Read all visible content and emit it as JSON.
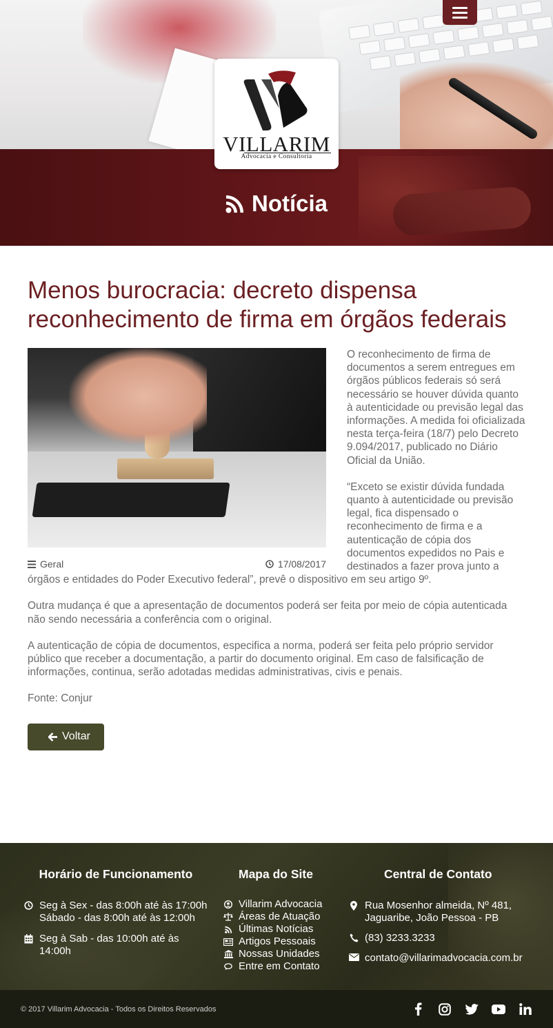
{
  "header": {
    "logo_name": "Villarim",
    "logo_subtitle": "Advocacia e Consultoria",
    "page_title": "Notícia",
    "menu_icon": "hamburger-icon",
    "title_icon": "rss-icon"
  },
  "article": {
    "title": "Menos burocracia: decreto dispensa reconhecimento de firma em órgãos federais",
    "category": "Geral",
    "date": "17/08/2017",
    "paragraphs": [
      "O reconhecimento de firma de documentos a serem entregues em órgãos públicos federais só será necessário se houver dúvida quanto à autenticidade ou previsão legal das informações. A medida foi oficializada nesta terça-feira (18/7) pelo Decreto 9.094/2017, publicado no Diário Oficial da União.",
      "“Exceto se existir dúvida fundada quanto à autenticidade ou previsão legal, fica dispensado o reconhecimento de firma e a autenticação de cópia dos documentos expedidos no Pais e destinados a fazer prova junto a órgãos e entidades do Poder Executivo federal”, prevê o dispositivo em seu artigo 9º.",
      "Outra mudança é que a apresentação de documentos poderá ser feita por meio de cópia autenticada não sendo necessária a conferência com o original.",
      "A autenticação de cópia de documentos, especifica a norma, poderá ser feita pelo próprio servidor público que receber a documentação, a partir do documento original. Em caso de falsificação de informações, continua, serão adotadas medidas administrativas, civis e penais.",
      "Fonte: Conjur"
    ],
    "back_button": "Voltar"
  },
  "footer": {
    "hours": {
      "title": "Horário de Funcionamento",
      "line1a": "Seg à Sex - das 8:00h até às 17:00h",
      "line1b": "Sábado - das 8:00h até às 12:00h",
      "line2": "Seg à Sab - das 10:00h até às 14:00h"
    },
    "sitemap": {
      "title": "Mapa do Site",
      "links": [
        {
          "label": "Villarim Advocacia",
          "icon": "user-circle-icon"
        },
        {
          "label": "Áreas de Atuação",
          "icon": "balance-scale-icon"
        },
        {
          "label": "Últimas Notícias",
          "icon": "rss-icon"
        },
        {
          "label": "Artigos Pessoais",
          "icon": "newspaper-icon"
        },
        {
          "label": "Nossas Unidades",
          "icon": "institution-icon"
        },
        {
          "label": "Entre em Contato",
          "icon": "comments-icon"
        }
      ]
    },
    "contact": {
      "title": "Central de Contato",
      "address": "Rua Mosenhor almeida, Nº 481, Jaguaribe, João Pessoa - PB",
      "phone": "(83) 3233.3233",
      "email": "contato@villarimadvocacia.com.br"
    },
    "copyright": "© 2017 Villarim Advocacia - Todos os Direitos Reservados",
    "social": [
      "facebook-icon",
      "instagram-icon",
      "twitter-icon",
      "youtube-icon",
      "linkedin-icon"
    ]
  },
  "colors": {
    "brand_red": "#6b1f22",
    "button_olive": "#474a2b",
    "footer_bg": "#2f311f",
    "bottom_bar": "#1c1d12"
  }
}
